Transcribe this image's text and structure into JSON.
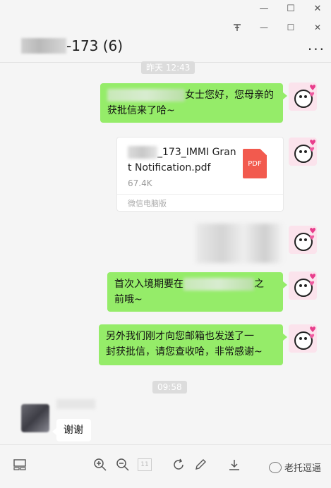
{
  "window": {
    "pin_icon": "pin-icon",
    "minimize_glyph": "—",
    "maximize_glyph": "☐",
    "close_glyph": "✕",
    "sub_pin_glyph": "ᴛ",
    "sub_minimize_glyph": "—",
    "sub_maximize_glyph": "☐",
    "sub_close_glyph": "✕"
  },
  "chat": {
    "title_suffix": "-173 (6)",
    "more_glyph": "···"
  },
  "messages": {
    "time1": "昨天 12:43",
    "msg1_text_a": "女士您好，您母亲的",
    "msg1_text_b": "获批信来了哈~",
    "file_name_a": "_173_IMMI Gra",
    "file_name_b": "nt Notification.pdf",
    "file_size": "67.4K",
    "file_badge": "PDF",
    "file_source": "微信电脑版",
    "msg3_text_a": "首次入境期要在",
    "msg3_text_b": "之",
    "msg3_text_c": "前哦~",
    "msg4_text_a": "另外我们刚才向您邮箱也发送了一",
    "msg4_text_b": "封获批信，请您查收哈，非常感谢~",
    "time2": "09:58",
    "reply_text": "谢谢"
  },
  "toolbar": {
    "page_box": "11",
    "watermark_text": "老托逗逼"
  },
  "colors": {
    "bubble_green": "#95ec69",
    "pdf_red": "#f25a4e",
    "background": "#f5f5f5"
  }
}
